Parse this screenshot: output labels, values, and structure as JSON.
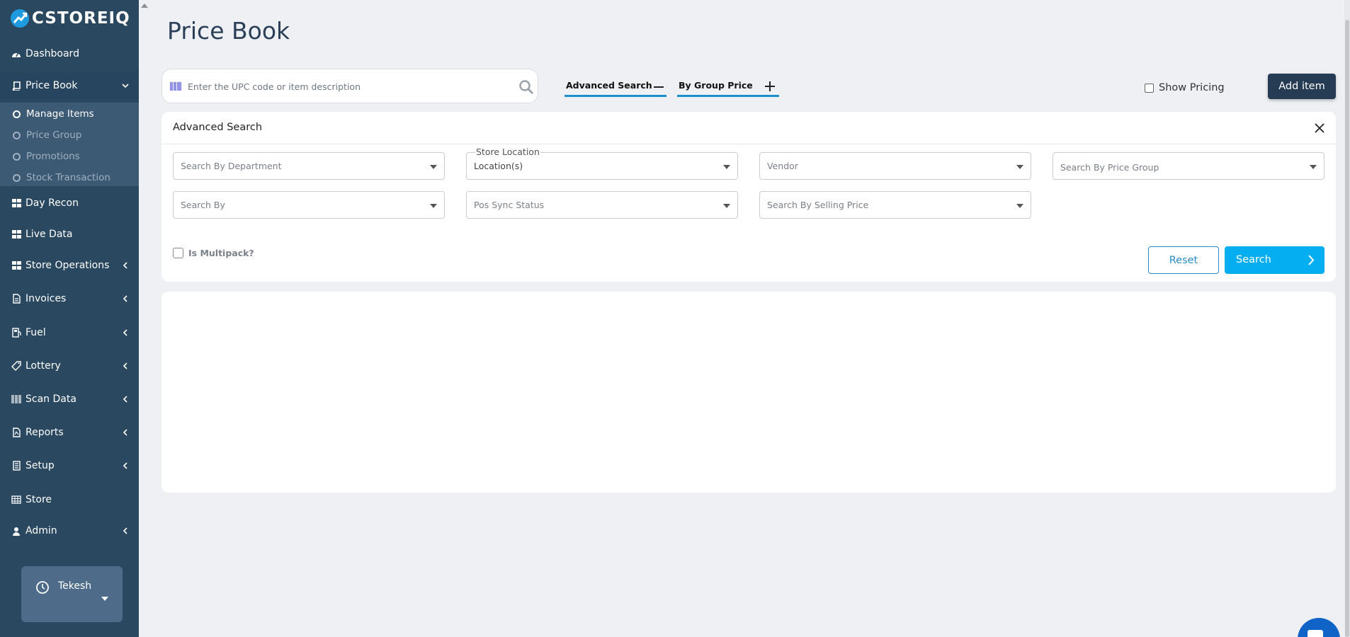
{
  "brand": {
    "name": "CSTOREIQ"
  },
  "sidebar": {
    "items": [
      {
        "label": "Dashboard",
        "icon": "dashboard-icon",
        "has_chevron": false
      },
      {
        "label": "Price Book",
        "icon": "book-icon",
        "has_chevron": true,
        "expanded": true
      },
      {
        "label": "Day Recon",
        "icon": "grid-icon",
        "has_chevron": false
      },
      {
        "label": "Live Data",
        "icon": "grid-icon",
        "has_chevron": false
      },
      {
        "label": "Store Operations",
        "icon": "grid-icon",
        "has_chevron": true
      },
      {
        "label": "Invoices",
        "icon": "file-icon",
        "has_chevron": true
      },
      {
        "label": "Fuel",
        "icon": "fuel-icon",
        "has_chevron": true
      },
      {
        "label": "Lottery",
        "icon": "ticket-icon",
        "has_chevron": true
      },
      {
        "label": "Scan Data",
        "icon": "barcode-icon",
        "has_chevron": true
      },
      {
        "label": "Reports",
        "icon": "pdf-icon",
        "has_chevron": true
      },
      {
        "label": "Setup",
        "icon": "building-icon",
        "has_chevron": true
      },
      {
        "label": "Store",
        "icon": "table-icon",
        "has_chevron": false
      },
      {
        "label": "Admin",
        "icon": "user-icon",
        "has_chevron": true
      }
    ],
    "sub_items": [
      {
        "label": "Manage Items",
        "current": true
      },
      {
        "label": "Price Group",
        "current": false
      },
      {
        "label": "Promotions",
        "current": false
      },
      {
        "label": "Stock Transaction",
        "current": false
      }
    ],
    "user": {
      "name": "Tekesh"
    }
  },
  "header": {
    "title": "Price Book"
  },
  "search": {
    "placeholder": "Enter the UPC code or item description",
    "value": ""
  },
  "tabs": {
    "advanced_search": "Advanced Search",
    "by_group_price": "By Group Price"
  },
  "show_pricing": {
    "label": "Show Pricing",
    "checked": false
  },
  "add_item": {
    "label": "Add item"
  },
  "advanced_panel": {
    "title": "Advanced Search",
    "filters": {
      "department": "Search By Department",
      "store_location_legend": "Store Location",
      "store_location_value": "Location(s)",
      "vendor": "Vendor",
      "price_group": "Search By Price Group",
      "search_by": "Search By",
      "pos_sync_status": "Pos Sync Status",
      "selling_price": "Search By Selling Price"
    },
    "multipack": {
      "label": "Is Multipack?",
      "checked": false
    },
    "reset_label": "Reset",
    "search_label": "Search"
  },
  "colors": {
    "sidebar_bg": "#2a4860",
    "accent": "#05aef0",
    "primary_dark": "#263c54",
    "tab_underline": "#1c8fd1"
  }
}
